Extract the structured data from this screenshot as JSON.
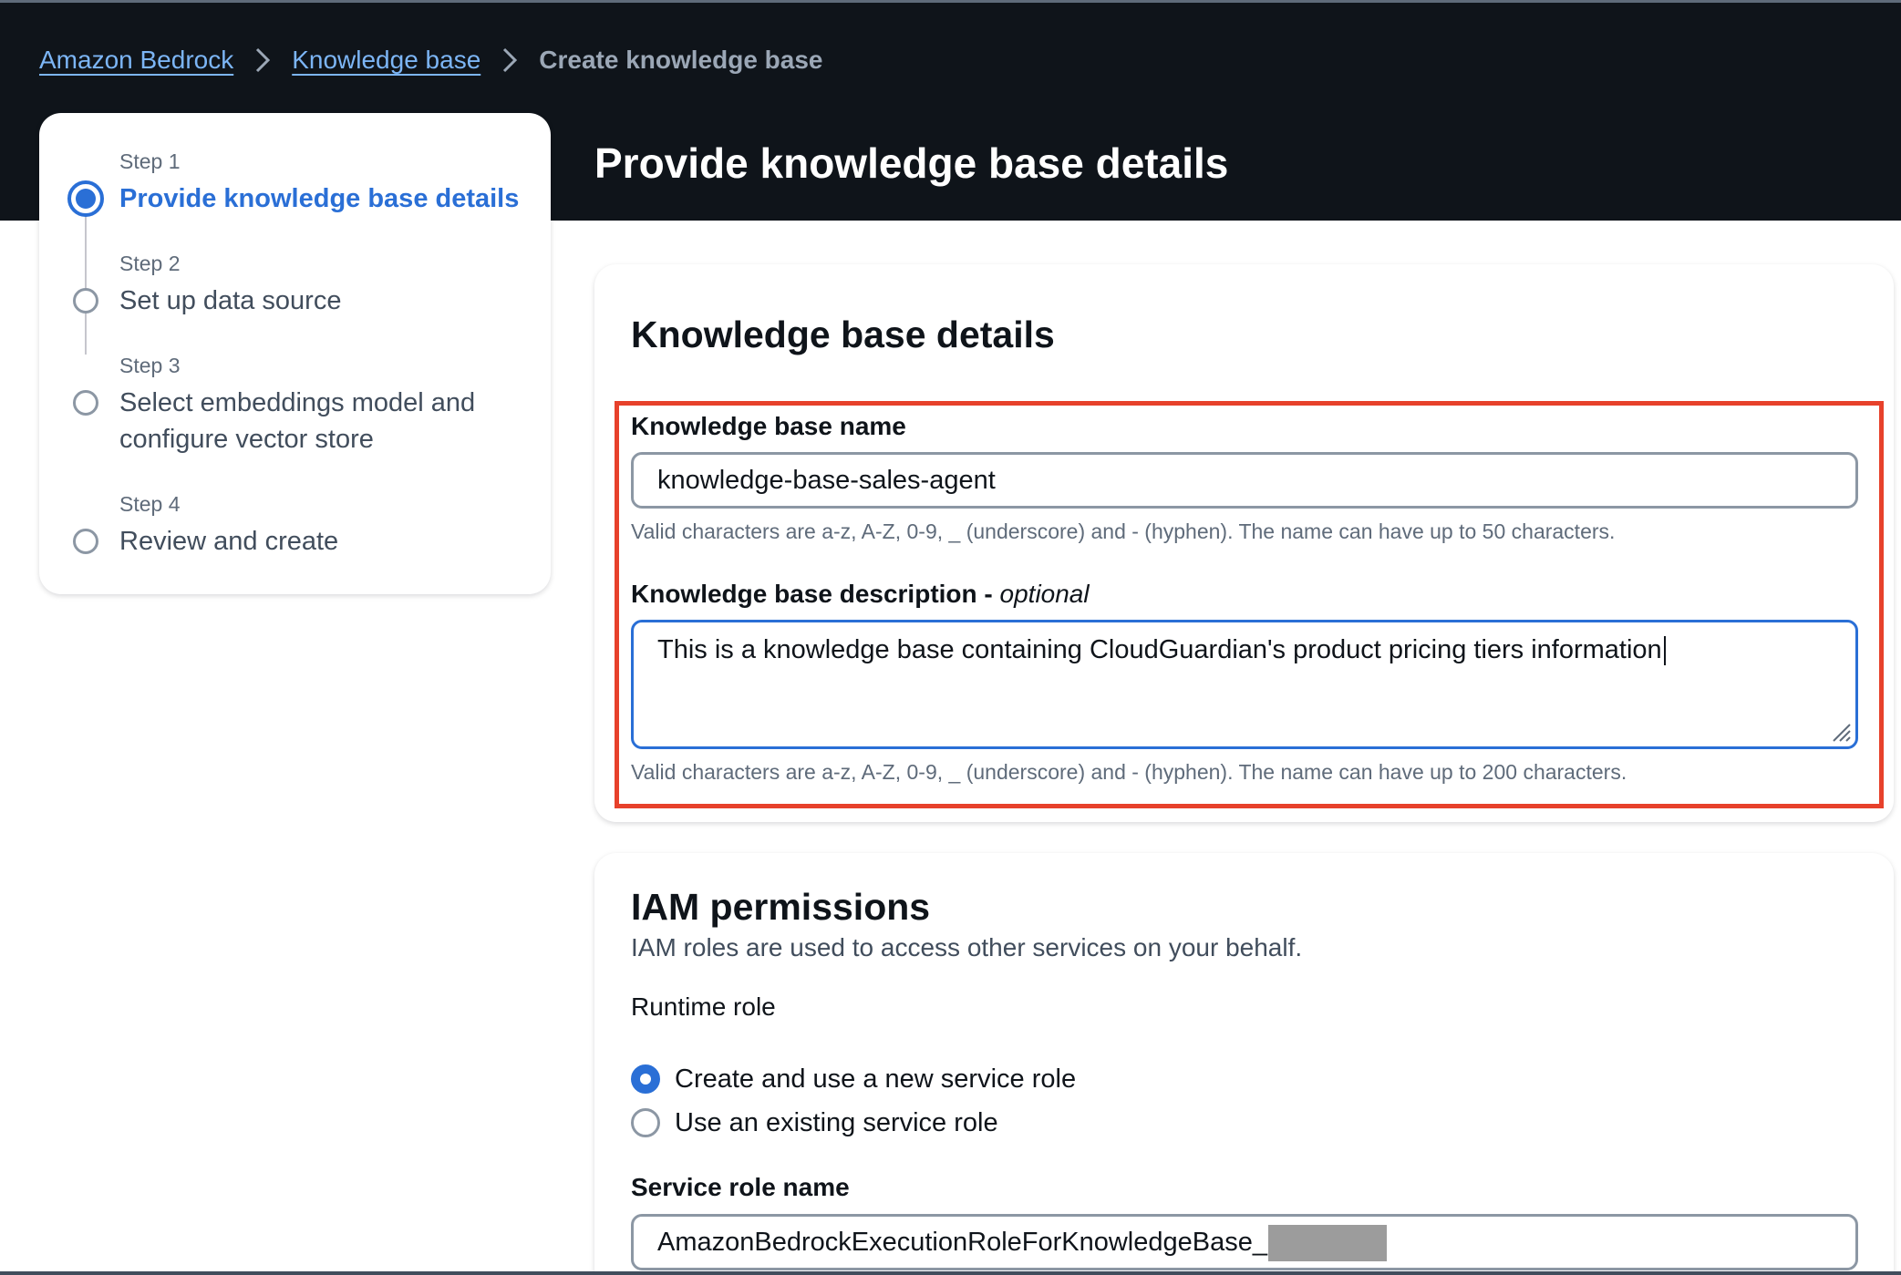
{
  "breadcrumb": {
    "items": [
      {
        "label": "Amazon Bedrock"
      },
      {
        "label": "Knowledge base"
      }
    ],
    "current": "Create knowledge base"
  },
  "steps": [
    {
      "number": "Step 1",
      "title": "Provide knowledge base details",
      "active": true
    },
    {
      "number": "Step 2",
      "title": "Set up data source",
      "active": false
    },
    {
      "number": "Step 3",
      "title_line1": "Select embeddings model and",
      "title_line2": "configure vector store",
      "active": false
    },
    {
      "number": "Step 4",
      "title": "Review and create",
      "active": false
    }
  ],
  "page_title": "Provide knowledge base details",
  "details": {
    "heading": "Knowledge base details",
    "name_label": "Knowledge base name",
    "name_value": "knowledge-base-sales-agent",
    "name_hint": "Valid characters are a-z, A-Z, 0-9, _ (underscore) and - (hyphen). The name can have up to 50 characters.",
    "description_label": "Knowledge base description - ",
    "description_optional": "optional",
    "description_value": "This is a knowledge base containing CloudGuardian's product pricing tiers information",
    "description_hint": "Valid characters are a-z, A-Z, 0-9, _ (underscore) and - (hyphen). The name can have up to 200 characters."
  },
  "iam": {
    "heading": "IAM permissions",
    "description": "IAM roles are used to access other services on your behalf.",
    "runtime_role_label": "Runtime role",
    "options": [
      {
        "label": "Create and use a new service role",
        "checked": true
      },
      {
        "label": "Use an existing service role",
        "checked": false
      }
    ],
    "service_role_label": "Service role name",
    "service_role_value": "AmazonBedrockExecutionRoleForKnowledgeBase_"
  },
  "colors": {
    "header_bg": "#0f141a",
    "link": "#7cb5f5",
    "accent": "#2a6fd6",
    "highlight": "#e7412b"
  }
}
